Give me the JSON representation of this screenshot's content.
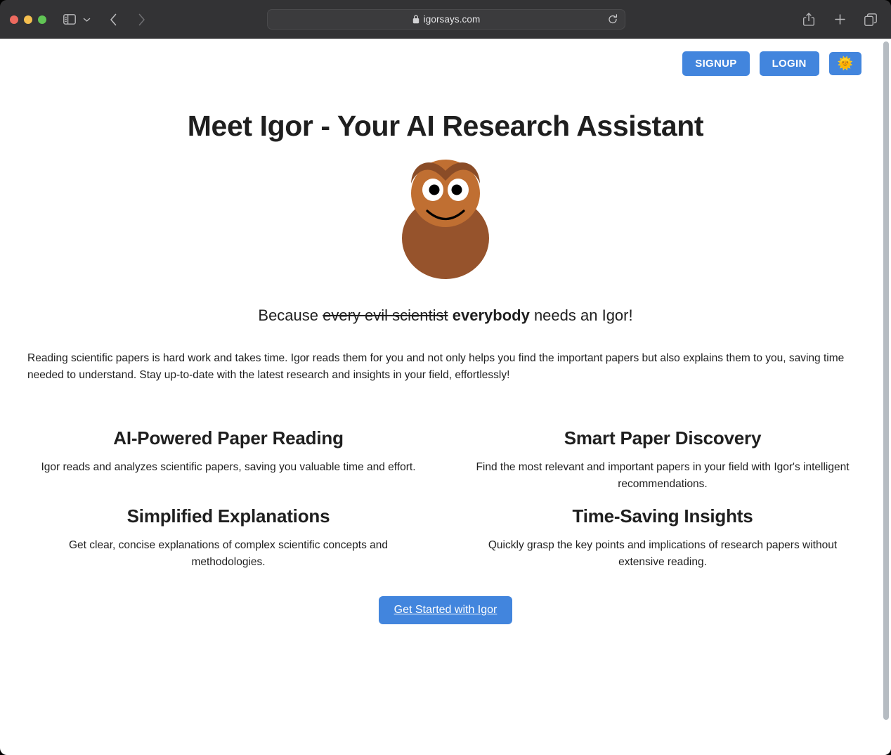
{
  "browser": {
    "url": "igorsays.com",
    "icons": {
      "lock": "lock-icon",
      "reload": "reload-icon",
      "sidebar": "sidebar-toggle-icon",
      "chevron_down": "chevron-down-icon",
      "back": "back-arrow-icon",
      "forward": "forward-arrow-icon",
      "share": "share-icon",
      "new_tab": "plus-icon",
      "tab_overview": "tab-overview-icon"
    },
    "traffic_lights": {
      "close": "close-window-button",
      "minimize": "minimize-window-button",
      "maximize": "maximize-window-button"
    },
    "colors": {
      "toolbar_bg": "#333335",
      "window_bg": "#2f2f31",
      "url_bg": "#3b3b3d"
    }
  },
  "page": {
    "header": {
      "signup_label": "SIGNUP",
      "login_label": "LOGIN",
      "theme_toggle_emoji": "🌞",
      "accent_color": "#4285dd"
    },
    "hero": {
      "title": "Meet Igor - Your AI Research Assistant",
      "mascot_name": "igor-owl-mascot",
      "mascot_colors": {
        "body": "#96532c",
        "head": "#c06f32",
        "brow": "#8a4c27",
        "eye_white": "#ffffff",
        "pupil": "#000000"
      },
      "tagline_prefix": "Because ",
      "tagline_struck": "every evil scientist",
      "tagline_bold": "everybody",
      "tagline_suffix": " needs an Igor!",
      "lede": "Reading scientific papers is hard work and takes time. Igor reads them for you and not only helps you find the important papers but also explains them to you, saving time needed to understand. Stay up-to-date with the latest research and insights in your field, effortlessly!"
    },
    "features": [
      {
        "title": "AI-Powered Paper Reading",
        "body": "Igor reads and analyzes scientific papers, saving you valuable time and effort."
      },
      {
        "title": "Smart Paper Discovery",
        "body": "Find the most relevant and important papers in your field with Igor's intelligent recommendations."
      },
      {
        "title": "Simplified Explanations",
        "body": "Get clear, concise explanations of complex scientific concepts and methodologies."
      },
      {
        "title": "Time-Saving Insights",
        "body": "Quickly grasp the key points and implications of research papers without extensive reading."
      }
    ],
    "cta": {
      "label": "Get Started with Igor"
    }
  }
}
